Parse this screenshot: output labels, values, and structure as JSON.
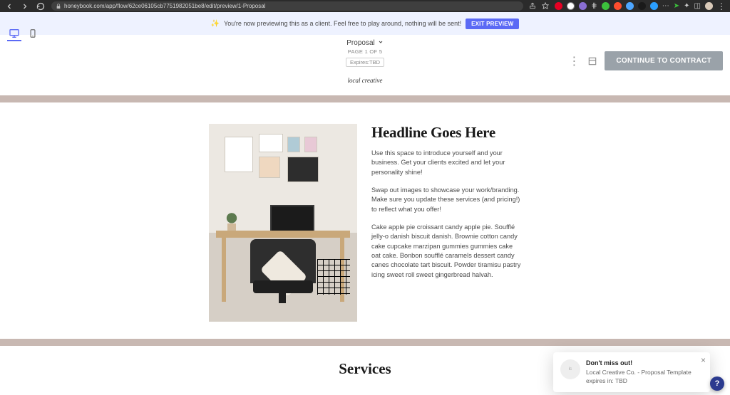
{
  "browser": {
    "url": "honeybook.com/app/flow/62ce06105cb7751982051be8/edit/preview/1-Proposal"
  },
  "banner": {
    "text": "You're now previewing this as a client. Feel free to play around, nothing will be sent!",
    "exit_label": "EXIT PREVIEW"
  },
  "toolbar": {
    "continue_label": "CONTINUE TO CONTRACT"
  },
  "doc": {
    "dropdown_label": "Proposal",
    "page_count": "PAGE 1 OF 5",
    "expires": "Expires:TBD",
    "brand": "local creative"
  },
  "content": {
    "headline": "Headline Goes Here",
    "p1": "Use this space to introduce yourself and your business. Get your clients excited and let your personality shine!",
    "p2": "Swap out images to showcase your work/branding. Make sure you update these services (and pricing!) to reflect what you offer!",
    "p3": "Cake apple pie croissant candy apple pie. Soufflé jelly-o danish biscuit danish. Brownie cotton candy cake cupcake marzipan gummies gummies cake oat cake. Bonbon soufflé caramels dessert candy canes chocolate tart biscuit. Powder tiramisu pastry icing sweet roll sweet gingerbread halvah."
  },
  "services_heading": "Services",
  "toast": {
    "title": "Don't miss out!",
    "body": "Local Creative Co. - Proposal Template expires in: TBD"
  },
  "help_label": "?"
}
